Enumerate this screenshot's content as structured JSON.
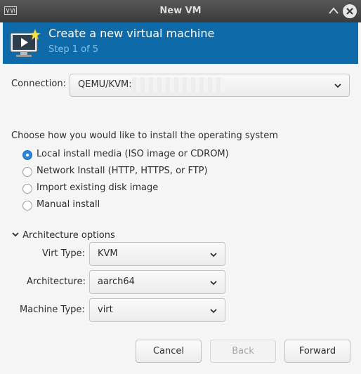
{
  "window": {
    "title": "New VM",
    "icons": {
      "app": "virt-manager-icon",
      "maximize": "maximize-icon",
      "close": "close-icon"
    }
  },
  "header": {
    "title": "Create a new virtual machine",
    "step": "Step 1 of 5",
    "icon": "vm-monitor-icon"
  },
  "connection": {
    "label": "Connection:",
    "value": "QEMU/KVM:"
  },
  "install": {
    "prompt": "Choose how you would like to install the operating system",
    "options": [
      {
        "label": "Local install media (ISO image or CDROM)",
        "selected": true
      },
      {
        "label": "Network Install (HTTP, HTTPS, or FTP)",
        "selected": false
      },
      {
        "label": "Import existing disk image",
        "selected": false
      },
      {
        "label": "Manual install",
        "selected": false
      }
    ]
  },
  "arch": {
    "expander": "Architecture options",
    "virt_type_label": "Virt Type:",
    "virt_type_value": "KVM",
    "architecture_label": "Architecture:",
    "architecture_value": "aarch64",
    "machine_type_label": "Machine Type:",
    "machine_type_value": "virt"
  },
  "buttons": {
    "cancel": "Cancel",
    "back": "Back",
    "forward": "Forward"
  },
  "colors": {
    "header_bg": "#0e6aa8",
    "selected_radio": "#2b85d8"
  }
}
